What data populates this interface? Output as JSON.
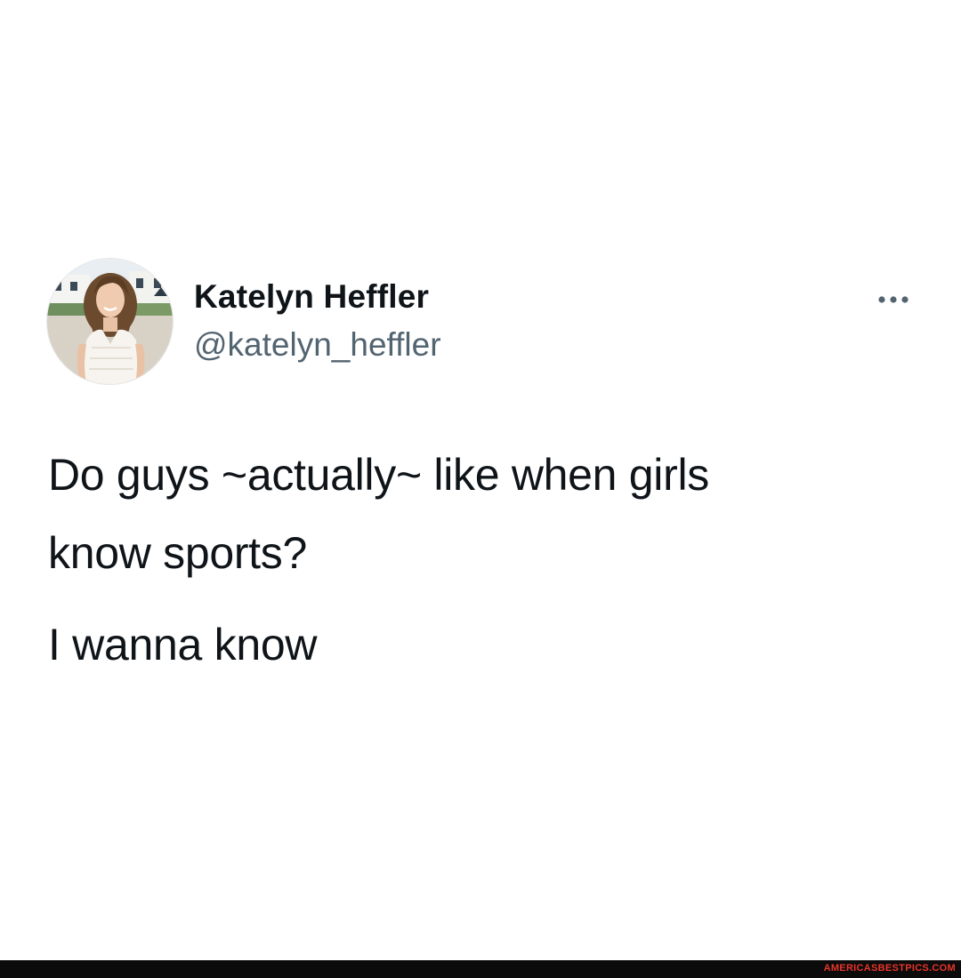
{
  "tweet": {
    "author": {
      "display_name": "Katelyn Heffler",
      "handle": "@katelyn_heffler",
      "avatar": "profile-photo"
    },
    "more_icon": "more-horizontal-icon",
    "text_lines": [
      "Do guys ~actually~ like when girls",
      "know sports?",
      "I wanna know"
    ]
  },
  "watermark": {
    "text": "AMERICASBESTPICS.COM"
  },
  "colors": {
    "background": "#ffffff",
    "text_primary": "#0f1419",
    "text_secondary": "#536471",
    "watermark_bar": "#0b0b0b",
    "watermark_text": "#e8342a"
  }
}
